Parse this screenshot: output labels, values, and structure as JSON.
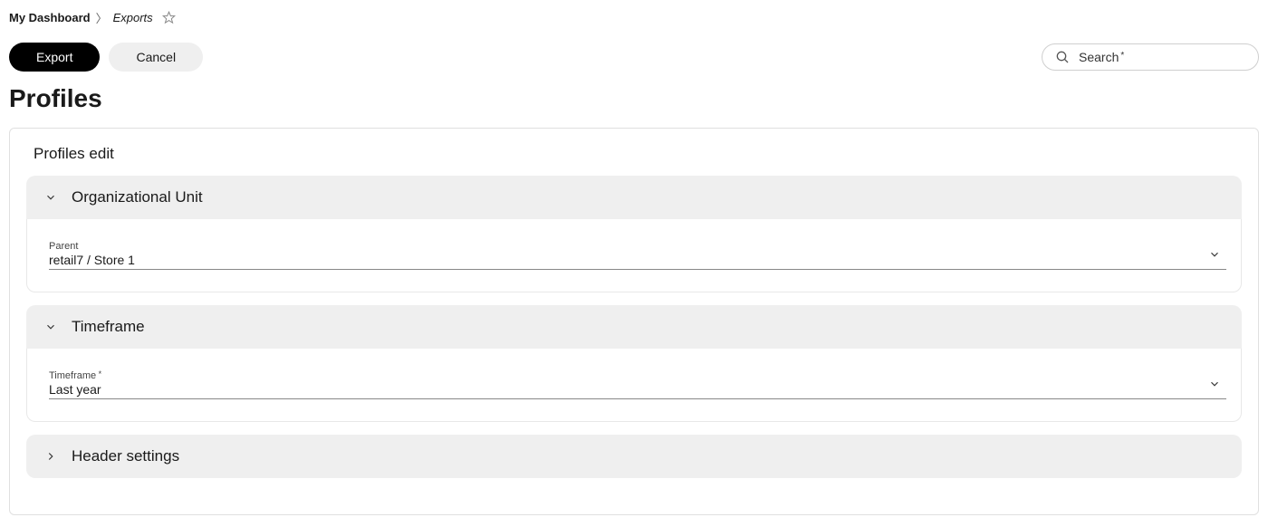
{
  "breadcrumb": {
    "root": "My Dashboard",
    "current": "Exports"
  },
  "actions": {
    "export_label": "Export",
    "cancel_label": "Cancel"
  },
  "search": {
    "label": "Search"
  },
  "page_title": "Profiles",
  "panel": {
    "title": "Profiles edit",
    "sections": {
      "org_unit": {
        "title": "Organizational Unit",
        "field_label": "Parent",
        "field_value": "retail7 / Store 1",
        "expanded": true
      },
      "timeframe": {
        "title": "Timeframe",
        "field_label": "Timeframe",
        "field_value": "Last year",
        "expanded": true
      },
      "header_settings": {
        "title": "Header settings",
        "expanded": false
      }
    }
  }
}
